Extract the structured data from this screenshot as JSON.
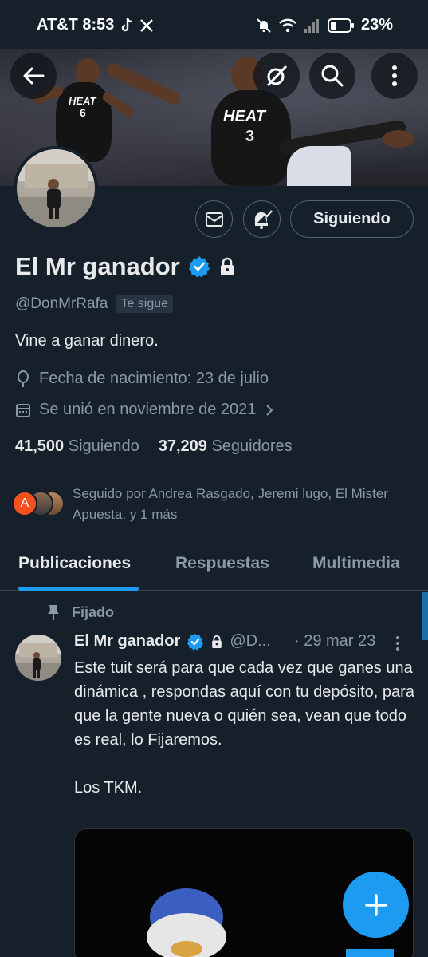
{
  "status_bar": {
    "carrier_time": "AT&T 8:53",
    "battery": "23%",
    "icons": [
      "tiktok-icon",
      "x-icon",
      "mute-icon",
      "wifi-icon",
      "signal-icon",
      "battery-icon"
    ]
  },
  "header": {
    "back_icon": "arrow-left-icon",
    "grok_icon": "grok-icon",
    "search_icon": "search-icon",
    "more_icon": "more-vertical-icon",
    "banner_jersey_1_team": "HEAT",
    "banner_jersey_1_number": "6",
    "banner_jersey_2_team": "HEAT",
    "banner_jersey_2_number": "3"
  },
  "profile": {
    "name": "El Mr ganador",
    "handle": "@DonMrRafa",
    "follows_you": "Te sigue",
    "bio": "Vine a ganar dinero.",
    "birthday": "Fecha de nacimiento: 23 de julio",
    "joined": "Se unió en noviembre de 2021",
    "following_count": "41,500",
    "following_label": "Siguiendo",
    "followers_count": "37,209",
    "followers_label": "Seguidores",
    "followed_by": "Seguido por Andrea Rasgado, Jeremi lugo, El Mister Apuesta. y 1 más",
    "followed_by_avatar_letter": "A",
    "verified_color": "#1d9bf0"
  },
  "actions": {
    "message_icon": "mail-icon",
    "notify_icon": "bell-check-icon",
    "follow_label": "Siguiendo"
  },
  "tabs": [
    {
      "label": "Publicaciones",
      "active": true
    },
    {
      "label": "Respuestas",
      "active": false
    },
    {
      "label": "Multimedia",
      "active": false
    }
  ],
  "tweet": {
    "pinned_label": "Fijado",
    "name": "El Mr ganador",
    "handle": "@D...",
    "date": "· 29 mar 23",
    "text": "Este tuit será para que cada vez que ganes una dinámica , respondas aquí con tu depósito, para que la gente nueva o quién sea, vean que todo es real, lo Fijaremos.\n\nLos TKM."
  },
  "fab": {
    "icon": "plus-icon"
  },
  "colors": {
    "background": "#15202b",
    "accent": "#1d9bf0",
    "secondary_text": "#8b98a5"
  }
}
